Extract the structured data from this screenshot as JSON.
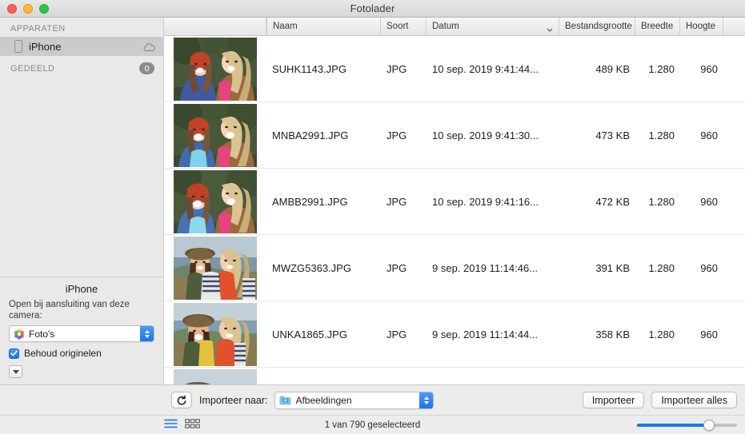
{
  "window": {
    "title": "Fotolader",
    "traffic_lights": [
      "close-button",
      "minimize-button",
      "zoom-button"
    ],
    "colors": {
      "accent": "#1a76ef",
      "sidebar_bg": "#e9e9e9",
      "selection": "#cbcbcb",
      "close": "#ff5f57",
      "minimize": "#febc2e",
      "maximize": "#28c840"
    }
  },
  "sidebar": {
    "sections": [
      {
        "title": "APPARATEN",
        "badge": null
      },
      {
        "title": "GEDEELD",
        "badge": "0"
      }
    ],
    "devices": [
      {
        "label": "iPhone",
        "icon": "iphone-icon",
        "status_icon": "cloud-icon",
        "selected": true
      }
    ],
    "device_panel": {
      "name": "iPhone",
      "description": "Open bij aansluiting van deze camera:",
      "app_popup": {
        "value": "Foto's",
        "icon": "photos-app-icon"
      },
      "checkbox": {
        "label": "Behoud originelen",
        "checked": true
      },
      "disclosure_icon": "disclosure-triangle-icon"
    }
  },
  "table": {
    "columns": [
      {
        "key": "thumb",
        "label": ""
      },
      {
        "key": "naam",
        "label": "Naam"
      },
      {
        "key": "soort",
        "label": "Soort"
      },
      {
        "key": "datum",
        "label": "Datum",
        "sorted": true,
        "sort_icon": "chevron-down-icon"
      },
      {
        "key": "grootte",
        "label": "Bestandsgrootte"
      },
      {
        "key": "breedte",
        "label": "Breedte"
      },
      {
        "key": "hoogte",
        "label": "Hoogte"
      }
    ],
    "rows": [
      {
        "naam": "SUHK1143.JPG",
        "soort": "JPG",
        "datum": "10 sep. 2019 9:41:44...",
        "grootte": "489 KB",
        "breedte": "1.280",
        "hoogte": "960",
        "scene": "park"
      },
      {
        "naam": "MNBA2991.JPG",
        "soort": "JPG",
        "datum": "10 sep. 2019 9:41:30...",
        "grootte": "473 KB",
        "breedte": "1.280",
        "hoogte": "960",
        "scene": "park"
      },
      {
        "naam": "AMBB2991.JPG",
        "soort": "JPG",
        "datum": "10 sep. 2019 9:41:16...",
        "grootte": "472 KB",
        "breedte": "1.280",
        "hoogte": "960",
        "scene": "park"
      },
      {
        "naam": "MWZG5363.JPG",
        "soort": "JPG",
        "datum": "9 sep. 2019 11:14:46...",
        "grootte": "391 KB",
        "breedte": "1.280",
        "hoogte": "960",
        "scene": "coast"
      },
      {
        "naam": "UNKA1865.JPG",
        "soort": "JPG",
        "datum": "9 sep. 2019 11:14:44...",
        "grootte": "358 KB",
        "breedte": "1.280",
        "hoogte": "960",
        "scene": "coast"
      },
      {
        "naam": "",
        "soort": "",
        "datum": "",
        "grootte": "",
        "breedte": "",
        "hoogte": "",
        "scene": "coast"
      }
    ]
  },
  "import_bar": {
    "rotate_icon": "rotate-icon",
    "destination_label": "Importeer naar:",
    "destination_value": "Afbeeldingen",
    "destination_icon": "folder-pictures-icon",
    "import_button": "Importeer",
    "import_all_button": "Importeer alles"
  },
  "status_bar": {
    "list_view_icon": "list-view-icon",
    "grid_view_icon": "grid-view-icon",
    "status_text": "1 van 790 geselecteerd",
    "zoom_value": 72
  }
}
